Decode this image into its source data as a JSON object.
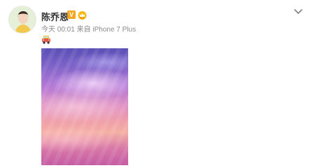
{
  "post": {
    "author": {
      "name": "陈乔恩",
      "verified_glyph": "V",
      "avatar_icon": "avatar-portrait",
      "vip_icon": "vip-crown-icon"
    },
    "meta": {
      "time": "今天 00:01",
      "via": "来自",
      "device": "iPhone 7 Plus"
    },
    "menu_icon": "chevron-down-icon",
    "content": {
      "emoji": "car-emoji",
      "image_description_icon": "sunset-clouds-photo"
    }
  },
  "colors": {
    "name": "#333333",
    "meta": "#8a8a8a",
    "badge": "#f5a623",
    "vip": "#f7b500"
  }
}
